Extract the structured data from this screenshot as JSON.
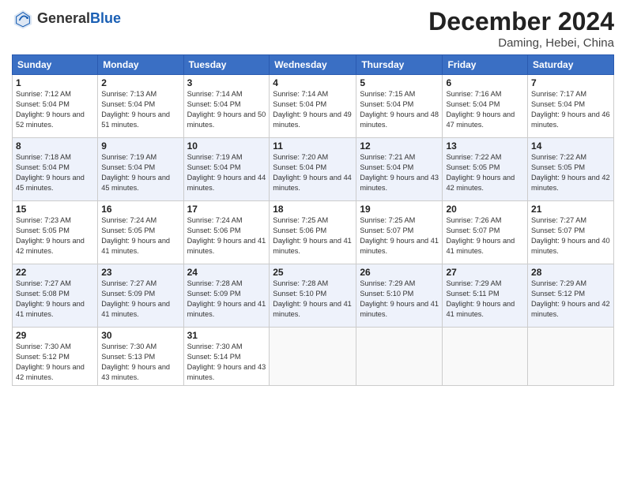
{
  "header": {
    "logo_general": "General",
    "logo_blue": "Blue",
    "month_title": "December 2024",
    "location": "Daming, Hebei, China"
  },
  "days_of_week": [
    "Sunday",
    "Monday",
    "Tuesday",
    "Wednesday",
    "Thursday",
    "Friday",
    "Saturday"
  ],
  "weeks": [
    [
      {
        "day": "1",
        "sunrise": "Sunrise: 7:12 AM",
        "sunset": "Sunset: 5:04 PM",
        "daylight": "Daylight: 9 hours and 52 minutes."
      },
      {
        "day": "2",
        "sunrise": "Sunrise: 7:13 AM",
        "sunset": "Sunset: 5:04 PM",
        "daylight": "Daylight: 9 hours and 51 minutes."
      },
      {
        "day": "3",
        "sunrise": "Sunrise: 7:14 AM",
        "sunset": "Sunset: 5:04 PM",
        "daylight": "Daylight: 9 hours and 50 minutes."
      },
      {
        "day": "4",
        "sunrise": "Sunrise: 7:14 AM",
        "sunset": "Sunset: 5:04 PM",
        "daylight": "Daylight: 9 hours and 49 minutes."
      },
      {
        "day": "5",
        "sunrise": "Sunrise: 7:15 AM",
        "sunset": "Sunset: 5:04 PM",
        "daylight": "Daylight: 9 hours and 48 minutes."
      },
      {
        "day": "6",
        "sunrise": "Sunrise: 7:16 AM",
        "sunset": "Sunset: 5:04 PM",
        "daylight": "Daylight: 9 hours and 47 minutes."
      },
      {
        "day": "7",
        "sunrise": "Sunrise: 7:17 AM",
        "sunset": "Sunset: 5:04 PM",
        "daylight": "Daylight: 9 hours and 46 minutes."
      }
    ],
    [
      {
        "day": "8",
        "sunrise": "Sunrise: 7:18 AM",
        "sunset": "Sunset: 5:04 PM",
        "daylight": "Daylight: 9 hours and 45 minutes."
      },
      {
        "day": "9",
        "sunrise": "Sunrise: 7:19 AM",
        "sunset": "Sunset: 5:04 PM",
        "daylight": "Daylight: 9 hours and 45 minutes."
      },
      {
        "day": "10",
        "sunrise": "Sunrise: 7:19 AM",
        "sunset": "Sunset: 5:04 PM",
        "daylight": "Daylight: 9 hours and 44 minutes."
      },
      {
        "day": "11",
        "sunrise": "Sunrise: 7:20 AM",
        "sunset": "Sunset: 5:04 PM",
        "daylight": "Daylight: 9 hours and 44 minutes."
      },
      {
        "day": "12",
        "sunrise": "Sunrise: 7:21 AM",
        "sunset": "Sunset: 5:04 PM",
        "daylight": "Daylight: 9 hours and 43 minutes."
      },
      {
        "day": "13",
        "sunrise": "Sunrise: 7:22 AM",
        "sunset": "Sunset: 5:05 PM",
        "daylight": "Daylight: 9 hours and 42 minutes."
      },
      {
        "day": "14",
        "sunrise": "Sunrise: 7:22 AM",
        "sunset": "Sunset: 5:05 PM",
        "daylight": "Daylight: 9 hours and 42 minutes."
      }
    ],
    [
      {
        "day": "15",
        "sunrise": "Sunrise: 7:23 AM",
        "sunset": "Sunset: 5:05 PM",
        "daylight": "Daylight: 9 hours and 42 minutes."
      },
      {
        "day": "16",
        "sunrise": "Sunrise: 7:24 AM",
        "sunset": "Sunset: 5:05 PM",
        "daylight": "Daylight: 9 hours and 41 minutes."
      },
      {
        "day": "17",
        "sunrise": "Sunrise: 7:24 AM",
        "sunset": "Sunset: 5:06 PM",
        "daylight": "Daylight: 9 hours and 41 minutes."
      },
      {
        "day": "18",
        "sunrise": "Sunrise: 7:25 AM",
        "sunset": "Sunset: 5:06 PM",
        "daylight": "Daylight: 9 hours and 41 minutes."
      },
      {
        "day": "19",
        "sunrise": "Sunrise: 7:25 AM",
        "sunset": "Sunset: 5:07 PM",
        "daylight": "Daylight: 9 hours and 41 minutes."
      },
      {
        "day": "20",
        "sunrise": "Sunrise: 7:26 AM",
        "sunset": "Sunset: 5:07 PM",
        "daylight": "Daylight: 9 hours and 41 minutes."
      },
      {
        "day": "21",
        "sunrise": "Sunrise: 7:27 AM",
        "sunset": "Sunset: 5:07 PM",
        "daylight": "Daylight: 9 hours and 40 minutes."
      }
    ],
    [
      {
        "day": "22",
        "sunrise": "Sunrise: 7:27 AM",
        "sunset": "Sunset: 5:08 PM",
        "daylight": "Daylight: 9 hours and 41 minutes."
      },
      {
        "day": "23",
        "sunrise": "Sunrise: 7:27 AM",
        "sunset": "Sunset: 5:09 PM",
        "daylight": "Daylight: 9 hours and 41 minutes."
      },
      {
        "day": "24",
        "sunrise": "Sunrise: 7:28 AM",
        "sunset": "Sunset: 5:09 PM",
        "daylight": "Daylight: 9 hours and 41 minutes."
      },
      {
        "day": "25",
        "sunrise": "Sunrise: 7:28 AM",
        "sunset": "Sunset: 5:10 PM",
        "daylight": "Daylight: 9 hours and 41 minutes."
      },
      {
        "day": "26",
        "sunrise": "Sunrise: 7:29 AM",
        "sunset": "Sunset: 5:10 PM",
        "daylight": "Daylight: 9 hours and 41 minutes."
      },
      {
        "day": "27",
        "sunrise": "Sunrise: 7:29 AM",
        "sunset": "Sunset: 5:11 PM",
        "daylight": "Daylight: 9 hours and 41 minutes."
      },
      {
        "day": "28",
        "sunrise": "Sunrise: 7:29 AM",
        "sunset": "Sunset: 5:12 PM",
        "daylight": "Daylight: 9 hours and 42 minutes."
      }
    ],
    [
      {
        "day": "29",
        "sunrise": "Sunrise: 7:30 AM",
        "sunset": "Sunset: 5:12 PM",
        "daylight": "Daylight: 9 hours and 42 minutes."
      },
      {
        "day": "30",
        "sunrise": "Sunrise: 7:30 AM",
        "sunset": "Sunset: 5:13 PM",
        "daylight": "Daylight: 9 hours and 43 minutes."
      },
      {
        "day": "31",
        "sunrise": "Sunrise: 7:30 AM",
        "sunset": "Sunset: 5:14 PM",
        "daylight": "Daylight: 9 hours and 43 minutes."
      },
      null,
      null,
      null,
      null
    ]
  ]
}
